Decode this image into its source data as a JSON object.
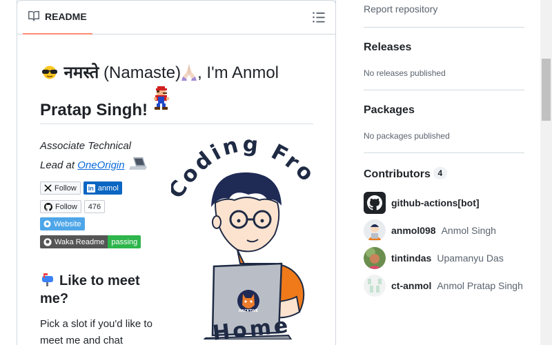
{
  "readme": {
    "tab_label": "README",
    "title_greeting": "नमस्ते",
    "title_namaste": " (Namaste)",
    "title_rest": ", I'm Anmol",
    "title_line2": "Pratap Singh!",
    "subtitle_line1": "Associate Technical",
    "subtitle_prefix": "Lead at ",
    "subtitle_link": "OneOrigin",
    "badges": {
      "x_follow": "Follow",
      "linkedin": "anmol",
      "github_follow": "Follow",
      "github_count": "476",
      "website": "Website",
      "waka_left": "Waka Readme",
      "waka_right": "passing"
    },
    "section_heading": "Like to meet me?",
    "paragraph": "Pick a slot if you'd like to meet me and chat",
    "hero_text_top": "Coding From",
    "hero_text_bottom": "Home",
    "hero_laptop_sticker": "HACKTIVE"
  },
  "sidebar": {
    "report_link": "Report repository",
    "releases": {
      "heading": "Releases",
      "empty": "No releases published"
    },
    "packages": {
      "heading": "Packages",
      "empty": "No packages published"
    },
    "contributors": {
      "heading": "Contributors",
      "count": "4",
      "items": [
        {
          "login": "github-actions[bot]",
          "name": ""
        },
        {
          "login": "anmol098",
          "name": "Anmol Singh"
        },
        {
          "login": "tintindas",
          "name": "Upamanyu Das"
        },
        {
          "login": "ct-anmol",
          "name": "Anmol Pratap Singh"
        }
      ]
    }
  },
  "colors": {
    "accent_link": "#0969da",
    "tab_underline": "#fd8c73",
    "muted_text": "#59636e",
    "border": "#d0d7de"
  }
}
